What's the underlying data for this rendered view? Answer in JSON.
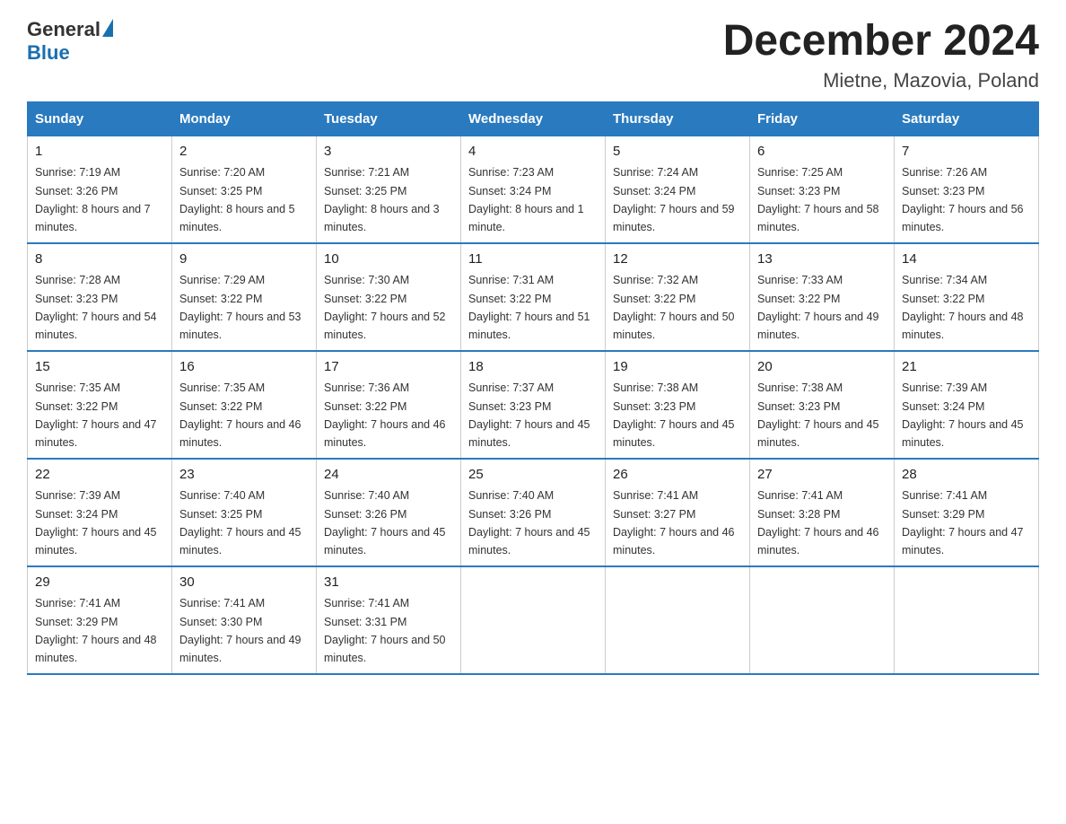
{
  "logo": {
    "general": "General",
    "blue": "Blue"
  },
  "title": "December 2024",
  "location": "Mietne, Mazovia, Poland",
  "days_of_week": [
    "Sunday",
    "Monday",
    "Tuesday",
    "Wednesday",
    "Thursday",
    "Friday",
    "Saturday"
  ],
  "weeks": [
    [
      {
        "day": "1",
        "sunrise": "7:19 AM",
        "sunset": "3:26 PM",
        "daylight": "8 hours and 7 minutes."
      },
      {
        "day": "2",
        "sunrise": "7:20 AM",
        "sunset": "3:25 PM",
        "daylight": "8 hours and 5 minutes."
      },
      {
        "day": "3",
        "sunrise": "7:21 AM",
        "sunset": "3:25 PM",
        "daylight": "8 hours and 3 minutes."
      },
      {
        "day": "4",
        "sunrise": "7:23 AM",
        "sunset": "3:24 PM",
        "daylight": "8 hours and 1 minute."
      },
      {
        "day": "5",
        "sunrise": "7:24 AM",
        "sunset": "3:24 PM",
        "daylight": "7 hours and 59 minutes."
      },
      {
        "day": "6",
        "sunrise": "7:25 AM",
        "sunset": "3:23 PM",
        "daylight": "7 hours and 58 minutes."
      },
      {
        "day": "7",
        "sunrise": "7:26 AM",
        "sunset": "3:23 PM",
        "daylight": "7 hours and 56 minutes."
      }
    ],
    [
      {
        "day": "8",
        "sunrise": "7:28 AM",
        "sunset": "3:23 PM",
        "daylight": "7 hours and 54 minutes."
      },
      {
        "day": "9",
        "sunrise": "7:29 AM",
        "sunset": "3:22 PM",
        "daylight": "7 hours and 53 minutes."
      },
      {
        "day": "10",
        "sunrise": "7:30 AM",
        "sunset": "3:22 PM",
        "daylight": "7 hours and 52 minutes."
      },
      {
        "day": "11",
        "sunrise": "7:31 AM",
        "sunset": "3:22 PM",
        "daylight": "7 hours and 51 minutes."
      },
      {
        "day": "12",
        "sunrise": "7:32 AM",
        "sunset": "3:22 PM",
        "daylight": "7 hours and 50 minutes."
      },
      {
        "day": "13",
        "sunrise": "7:33 AM",
        "sunset": "3:22 PM",
        "daylight": "7 hours and 49 minutes."
      },
      {
        "day": "14",
        "sunrise": "7:34 AM",
        "sunset": "3:22 PM",
        "daylight": "7 hours and 48 minutes."
      }
    ],
    [
      {
        "day": "15",
        "sunrise": "7:35 AM",
        "sunset": "3:22 PM",
        "daylight": "7 hours and 47 minutes."
      },
      {
        "day": "16",
        "sunrise": "7:35 AM",
        "sunset": "3:22 PM",
        "daylight": "7 hours and 46 minutes."
      },
      {
        "day": "17",
        "sunrise": "7:36 AM",
        "sunset": "3:22 PM",
        "daylight": "7 hours and 46 minutes."
      },
      {
        "day": "18",
        "sunrise": "7:37 AM",
        "sunset": "3:23 PM",
        "daylight": "7 hours and 45 minutes."
      },
      {
        "day": "19",
        "sunrise": "7:38 AM",
        "sunset": "3:23 PM",
        "daylight": "7 hours and 45 minutes."
      },
      {
        "day": "20",
        "sunrise": "7:38 AM",
        "sunset": "3:23 PM",
        "daylight": "7 hours and 45 minutes."
      },
      {
        "day": "21",
        "sunrise": "7:39 AM",
        "sunset": "3:24 PM",
        "daylight": "7 hours and 45 minutes."
      }
    ],
    [
      {
        "day": "22",
        "sunrise": "7:39 AM",
        "sunset": "3:24 PM",
        "daylight": "7 hours and 45 minutes."
      },
      {
        "day": "23",
        "sunrise": "7:40 AM",
        "sunset": "3:25 PM",
        "daylight": "7 hours and 45 minutes."
      },
      {
        "day": "24",
        "sunrise": "7:40 AM",
        "sunset": "3:26 PM",
        "daylight": "7 hours and 45 minutes."
      },
      {
        "day": "25",
        "sunrise": "7:40 AM",
        "sunset": "3:26 PM",
        "daylight": "7 hours and 45 minutes."
      },
      {
        "day": "26",
        "sunrise": "7:41 AM",
        "sunset": "3:27 PM",
        "daylight": "7 hours and 46 minutes."
      },
      {
        "day": "27",
        "sunrise": "7:41 AM",
        "sunset": "3:28 PM",
        "daylight": "7 hours and 46 minutes."
      },
      {
        "day": "28",
        "sunrise": "7:41 AM",
        "sunset": "3:29 PM",
        "daylight": "7 hours and 47 minutes."
      }
    ],
    [
      {
        "day": "29",
        "sunrise": "7:41 AM",
        "sunset": "3:29 PM",
        "daylight": "7 hours and 48 minutes."
      },
      {
        "day": "30",
        "sunrise": "7:41 AM",
        "sunset": "3:30 PM",
        "daylight": "7 hours and 49 minutes."
      },
      {
        "day": "31",
        "sunrise": "7:41 AM",
        "sunset": "3:31 PM",
        "daylight": "7 hours and 50 minutes."
      },
      null,
      null,
      null,
      null
    ]
  ],
  "labels": {
    "sunrise": "Sunrise:",
    "sunset": "Sunset:",
    "daylight": "Daylight:"
  }
}
